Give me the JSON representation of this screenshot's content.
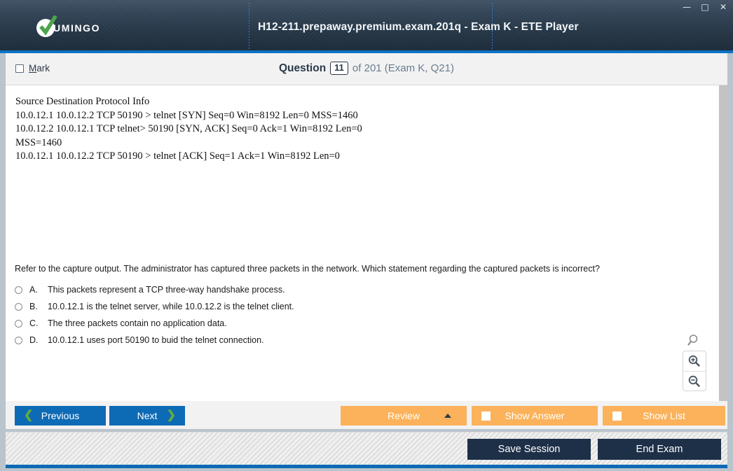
{
  "window": {
    "app_title": "H12-211.prepaway.premium.exam.201q - Exam K - ETE Player",
    "minimize": "—",
    "maximize": "□",
    "close": "✕",
    "accent_color": "#0b72c4",
    "header_gradient_top": "#415365",
    "header_gradient_bottom": "#1c2a38"
  },
  "brand": {
    "logo_text": "UMINGO",
    "check_color": "#4ca54c"
  },
  "question_bar": {
    "mark_label_prefix": "",
    "mark_label": "Mark",
    "mark_accel": "M",
    "mark_rest": "ark",
    "question_word": "Question",
    "question_number": "11",
    "of_text": "of 201 (Exam K, Q21)"
  },
  "content": {
    "capture_output": "Source Destination Protocol Info\n10.0.12.1 10.0.12.2 TCP 50190 > telnet [SYN] Seq=0 Win=8192 Len=0 MSS=1460\n10.0.12.2 10.0.12.1 TCP telnet> 50190 [SYN, ACK] Seq=0 Ack=1 Win=8192 Len=0\nMSS=1460\n10.0.12.1 10.0.12.2 TCP 50190 > telnet [ACK] Seq=1 Ack=1 Win=8192 Len=0",
    "question_text": "Refer to the capture output. The administrator has captured three packets in the network. Which statement regarding the captured packets is incorrect?",
    "options": [
      {
        "letter": "A.",
        "text": "This packets represent a TCP three-way handshake process.",
        "selected": false
      },
      {
        "letter": "B.",
        "text": "10.0.12.1 is the telnet server, while 10.0.12.2 is the telnet client.",
        "selected": false
      },
      {
        "letter": "C.",
        "text": "The three packets contain no application data.",
        "selected": false
      },
      {
        "letter": "D.",
        "text": "10.0.12.1 uses port 50190 to buid the telnet connection.",
        "selected": false
      }
    ]
  },
  "zoom_tools": {
    "search_icon": "magnifier-icon",
    "zoom_in_icon": "magnifier-plus-icon",
    "zoom_out_icon": "magnifier-minus-icon"
  },
  "actions": {
    "previous": "Previous",
    "next": "Next",
    "review": "Review",
    "show_answer": "Show Answer",
    "show_list": "Show List",
    "prev_chevron": "❮",
    "next_chevron": "❯",
    "blue_color": "#0d6ab5",
    "orange_color": "#fbb25a",
    "chevron_color": "#64ad3a"
  },
  "status": {
    "save_session": "Save Session",
    "end_exam": "End Exam",
    "dark_color": "#1e3048"
  }
}
